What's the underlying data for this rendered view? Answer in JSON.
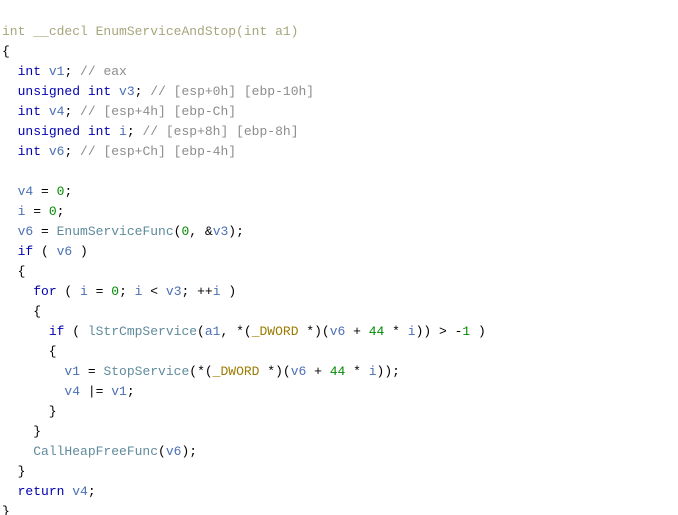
{
  "code": {
    "l01a": "int",
    "l01b": "__cdecl EnumServiceAndStop(",
    "l01c": "int",
    "l01d": " a1",
    "l01e": ")",
    "l02a": "{",
    "l03a": "  ",
    "l03b": "int",
    "l03c": " ",
    "l03d": "v1",
    "l03e": "; ",
    "l03f": "// eax",
    "l04a": "  ",
    "l04b": "unsigned int",
    "l04c": " ",
    "l04d": "v3",
    "l04e": "; ",
    "l04f": "// [esp+0h] [ebp-10h]",
    "l05a": "  ",
    "l05b": "int",
    "l05c": " ",
    "l05d": "v4",
    "l05e": "; ",
    "l05f": "// [esp+4h] [ebp-Ch]",
    "l06a": "  ",
    "l06b": "unsigned int",
    "l06c": " ",
    "l06d": "i",
    "l06e": "; ",
    "l06f": "// [esp+8h] [ebp-8h]",
    "l07a": "  ",
    "l07b": "int",
    "l07c": " ",
    "l07d": "v6",
    "l07e": "; ",
    "l07f": "// [esp+Ch] [ebp-4h]",
    "l08a": "",
    "l09a": "  ",
    "l09b": "v4",
    "l09c": " = ",
    "l09d": "0",
    "l09e": ";",
    "l10a": "  ",
    "l10b": "i",
    "l10c": " = ",
    "l10d": "0",
    "l10e": ";",
    "l11a": "  ",
    "l11b": "v6",
    "l11c": " = ",
    "l11d": "EnumServiceFunc",
    "l11e": "(",
    "l11f": "0",
    "l11g": ", &",
    "l11h": "v3",
    "l11i": ");",
    "l12a": "  ",
    "l12b": "if",
    "l12c": " ( ",
    "l12d": "v6",
    "l12e": " )",
    "l13a": "  {",
    "l14a": "    ",
    "l14b": "for",
    "l14c": " ( ",
    "l14d": "i",
    "l14e": " = ",
    "l14f": "0",
    "l14g": "; ",
    "l14h": "i",
    "l14i": " < ",
    "l14j": "v3",
    "l14k": "; ++",
    "l14l": "i",
    "l14m": " )",
    "l15a": "    {",
    "l16a": "      ",
    "l16b": "if",
    "l16c": " ( ",
    "l16d": "lStrCmpService",
    "l16e": "(",
    "l16f": "a1",
    "l16g": ", *(",
    "l16h": "_DWORD",
    "l16i": " *)(",
    "l16j": "v6",
    "l16k": " + ",
    "l16l": "44",
    "l16m": " * ",
    "l16n": "i",
    "l16o": ")) > -",
    "l16p": "1",
    "l16q": " )",
    "l17a": "      {",
    "l18a": "        ",
    "l18b": "v1",
    "l18c": " = ",
    "l18d": "StopService",
    "l18e": "(*(",
    "l18f": "_DWORD",
    "l18g": " *)(",
    "l18h": "v6",
    "l18i": " + ",
    "l18j": "44",
    "l18k": " * ",
    "l18l": "i",
    "l18m": "));",
    "l19a": "        ",
    "l19b": "v4",
    "l19c": " |= ",
    "l19d": "v1",
    "l19e": ";",
    "l20a": "      }",
    "l21a": "    }",
    "l22a": "    ",
    "l22b": "CallHeapFreeFunc",
    "l22c": "(",
    "l22d": "v6",
    "l22e": ");",
    "l23a": "  }",
    "l24a": "  ",
    "l24b": "return",
    "l24c": " ",
    "l24d": "v4",
    "l24e": ";",
    "l25a": "}"
  }
}
